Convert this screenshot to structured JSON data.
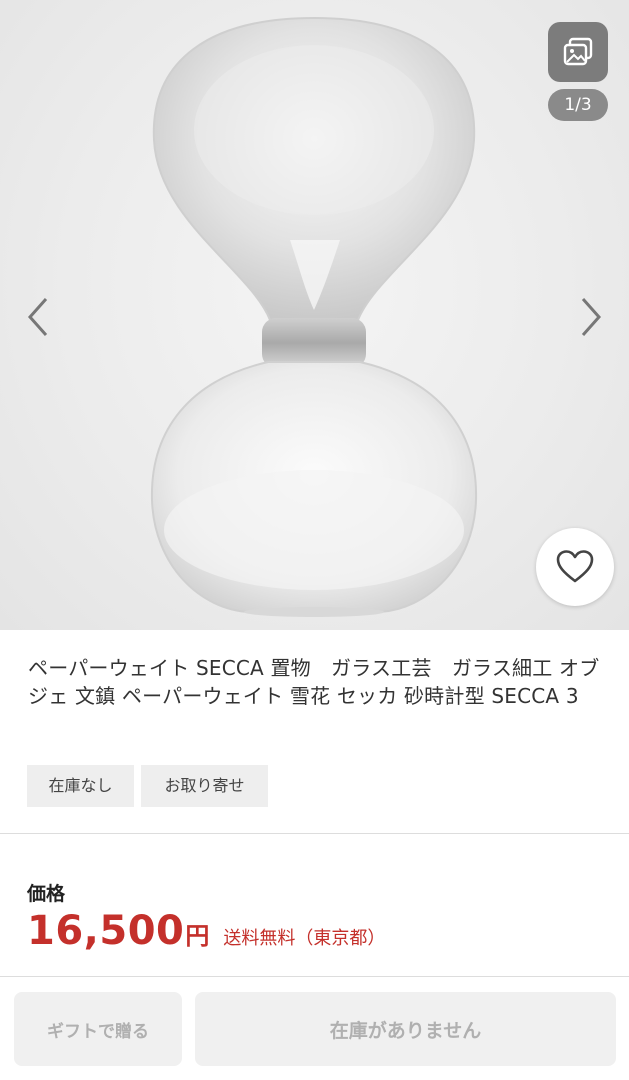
{
  "gallery": {
    "icon": "gallery-icon",
    "counter": "1/3",
    "prev_icon": "chevron-left-icon",
    "next_icon": "chevron-right-icon",
    "favorite_icon": "heart-icon"
  },
  "product": {
    "title": "ペーパーウェイト SECCA 置物　ガラス工芸　ガラス細工 オブジェ 文鎮 ペーパーウェイト 雪花 セッカ 砂時計型 SECCA 3",
    "tags": [
      "在庫なし",
      "お取り寄せ"
    ]
  },
  "price": {
    "label": "価格",
    "amount": "16,500",
    "currency": "円",
    "shipping": "送料無料（東京都）"
  },
  "actions": {
    "gift_label": "ギフトで贈る",
    "cart_label": "在庫がありません"
  },
  "colors": {
    "price_red": "#c4302b",
    "disabled_text": "#b0b0b0"
  }
}
